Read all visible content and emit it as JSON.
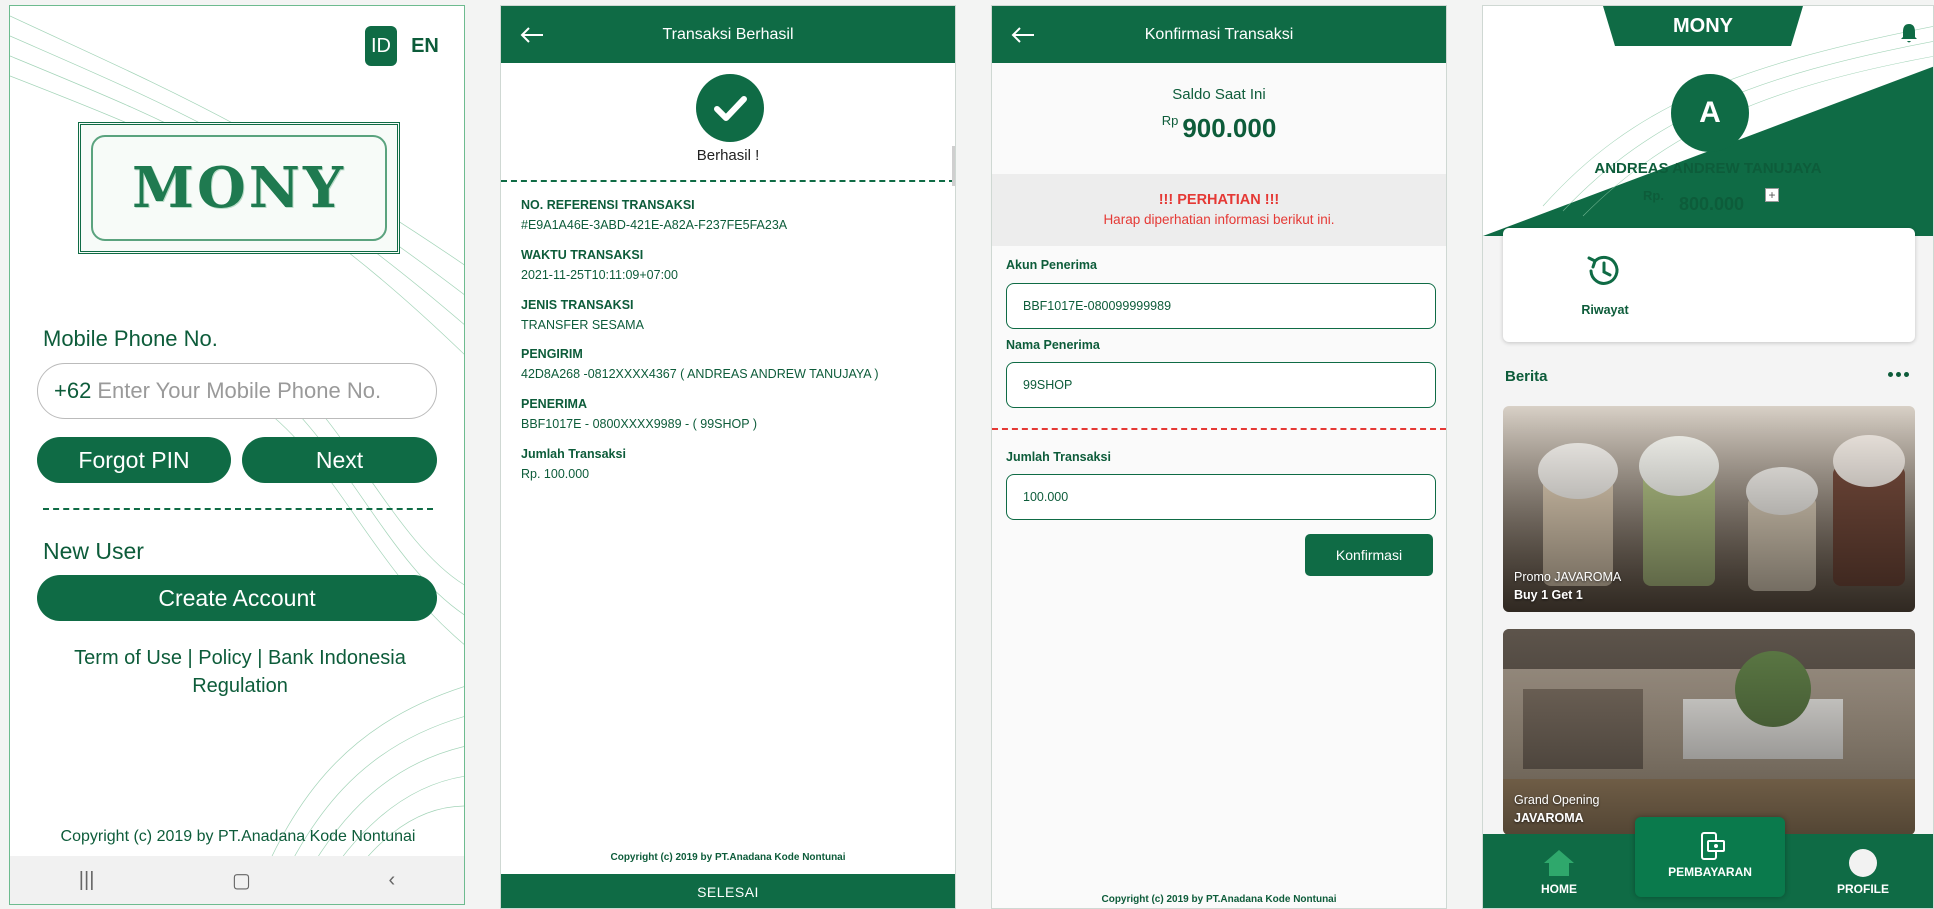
{
  "login": {
    "lang_id": "ID",
    "lang_en": "EN",
    "logo_text": "MONY",
    "phone_label": "Mobile Phone No.",
    "country_code": "+62",
    "phone_placeholder": "Enter Your Mobile Phone No.",
    "forgot_pin": "Forgot PIN",
    "next": "Next",
    "new_user": "New User",
    "create_account": "Create Account",
    "links_line1": "Term of Use | Policy | Bank Indonesia",
    "links_line2": "Regulation",
    "copyright": "Copyright (c) 2019 by PT.Anadana Kode Nontunai",
    "nav_recent": "|||",
    "nav_home": "▢",
    "nav_back": "‹"
  },
  "success": {
    "title": "Transaksi Berhasil",
    "status": "Berhasil !",
    "fields": [
      {
        "key": "NO. REFERENSI TRANSAKSI",
        "value": "#E9A1A46E-3ABD-421E-A82A-F237FE5FA23A"
      },
      {
        "key": "WAKTU TRANSAKSI",
        "value": "2021-11-25T10:11:09+07:00"
      },
      {
        "key": "JENIS TRANSAKSI",
        "value": "TRANSFER SESAMA"
      },
      {
        "key": "PENGIRIM",
        "value": "42D8A268 -0812XXXX4367 ( ANDREAS ANDREW TANUJAYA )"
      },
      {
        "key": "PENERIMA",
        "value": "BBF1017E - 0800XXXX9989 - ( 99SHOP )"
      },
      {
        "key": "Jumlah Transaksi",
        "value": "Rp. 100.000"
      }
    ],
    "copyright": "Copyright (c) 2019 by PT.Anadana Kode Nontunai",
    "done_button": "SELESAI"
  },
  "confirm": {
    "title": "Konfirmasi Transaksi",
    "saldo_label": "Saldo Saat Ini",
    "currency": "Rp",
    "saldo_value": "900.000",
    "warning_title": "!!! PERHATIAN !!!",
    "warning_text": "Harap diperhatian informasi berikut ini.",
    "akun_label": "Akun Penerima",
    "akun_value": "BBF1017E-080099999989",
    "nama_label": "Nama Penerima",
    "nama_value": "99SHOP",
    "jumlah_label": "Jumlah Transaksi",
    "jumlah_value": "100.000",
    "confirm_button": "Konfirmasi",
    "copyright": "Copyright (c) 2019 by PT.Anadana Kode Nontunai"
  },
  "home": {
    "brand": "MONY",
    "avatar_initial": "A",
    "user_name": "ANDREAS ANDREW TANUJAYA",
    "currency": "Rp.",
    "balance": "800.000",
    "topup": "+",
    "riwayat": "Riwayat",
    "news_title": "Berita",
    "news": [
      {
        "line1": "Promo JAVAROMA",
        "line2": "Buy 1 Get 1"
      },
      {
        "line1": "Grand Opening",
        "line2": "JAVAROMA"
      }
    ],
    "nav_home": "HOME",
    "nav_pay": "PEMBAYARAN",
    "nav_profile": "PROFILE"
  },
  "colors": {
    "primary": "#0f6b45",
    "warning": "#e53935",
    "text": "#0d5c3a"
  }
}
